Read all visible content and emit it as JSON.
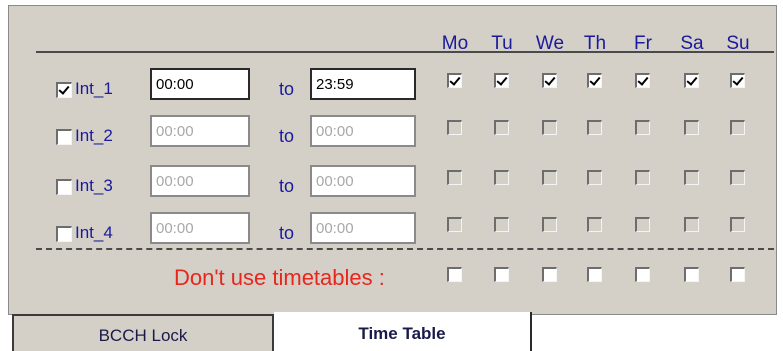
{
  "days": [
    "Mo",
    "Tu",
    "We",
    "Th",
    "Fr",
    "Sa",
    "Su"
  ],
  "intervals": [
    {
      "label": "Int_1",
      "enabled": true,
      "from": "00:00",
      "to_label": "to",
      "to": "23:59",
      "days": [
        true,
        true,
        true,
        true,
        true,
        true,
        true
      ]
    },
    {
      "label": "Int_2",
      "enabled": false,
      "from": "00:00",
      "to_label": "to",
      "to": "00:00",
      "days": [
        false,
        false,
        false,
        false,
        false,
        false,
        false
      ]
    },
    {
      "label": "Int_3",
      "enabled": false,
      "from": "00:00",
      "to_label": "to",
      "to": "00:00",
      "days": [
        false,
        false,
        false,
        false,
        false,
        false,
        false
      ]
    },
    {
      "label": "Int_4",
      "enabled": false,
      "from": "00:00",
      "to_label": "to",
      "to": "00:00",
      "days": [
        false,
        false,
        false,
        false,
        false,
        false,
        false
      ]
    }
  ],
  "dont_use": {
    "label": "Don't use timetables :",
    "days": [
      false,
      false,
      false,
      false,
      false,
      false,
      false
    ]
  },
  "tabs": {
    "bcch_lock": "BCCH Lock",
    "time_table": "Time Table",
    "active": "Time Table"
  },
  "colors": {
    "panel_bg": "#d4d0c8",
    "label_blue": "#1a1a9a",
    "warning_red": "#e8261c",
    "disabled_text": "#a8a8a8"
  }
}
